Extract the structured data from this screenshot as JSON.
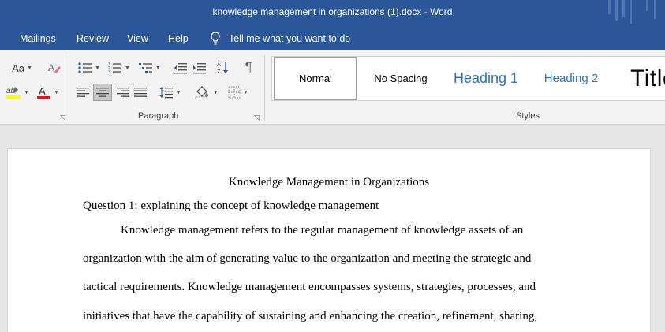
{
  "window": {
    "title": "knowledge management in organizations (1).docx  -  Word"
  },
  "menu": {
    "items": [
      "Mailings",
      "Review",
      "View",
      "Help"
    ],
    "tell_me": "Tell me what you want to do"
  },
  "ribbon": {
    "paragraph_label": "Paragraph",
    "styles_label": "Styles",
    "font_case_label": "Aa",
    "styles": [
      "Normal",
      "No Spacing",
      "Heading 1",
      "Heading 2",
      "Title"
    ],
    "active_style": "Normal",
    "icons": {
      "change_case": "change-case-icon",
      "clear_formatting": "clear-formatting-icon",
      "highlight": "text-highlight-icon",
      "font_color": "font-color-icon",
      "bullets": "bullets-icon",
      "numbering": "numbering-icon",
      "multilevel": "multilevel-list-icon",
      "decrease_indent": "decrease-indent-icon",
      "increase_indent": "increase-indent-icon",
      "sort": "sort-icon",
      "show_marks": "pilcrow-icon",
      "align_left": "align-left-icon",
      "align_center": "align-center-icon",
      "align_right": "align-right-icon",
      "justify": "justify-icon",
      "line_spacing": "line-spacing-icon",
      "shading": "shading-icon",
      "borders": "borders-icon"
    },
    "colors": {
      "highlight": "#ffff00",
      "font_color": "#e81123"
    }
  },
  "document": {
    "title": "Knowledge Management in Organizations",
    "question": "Question 1: explaining the concept of knowledge management",
    "lines": [
      "Knowledge management refers to the regular management of knowledge assets of an",
      "organization with the aim of generating value to the organization and meeting the strategic and",
      "tactical requirements. Knowledge management encompasses systems, strategies, processes, and",
      "initiatives that have the capability of sustaining and enhancing the creation, refinement, sharing,"
    ]
  },
  "colors": {
    "title_bar": "#2b579a",
    "heading_style": "#2e74b5"
  }
}
